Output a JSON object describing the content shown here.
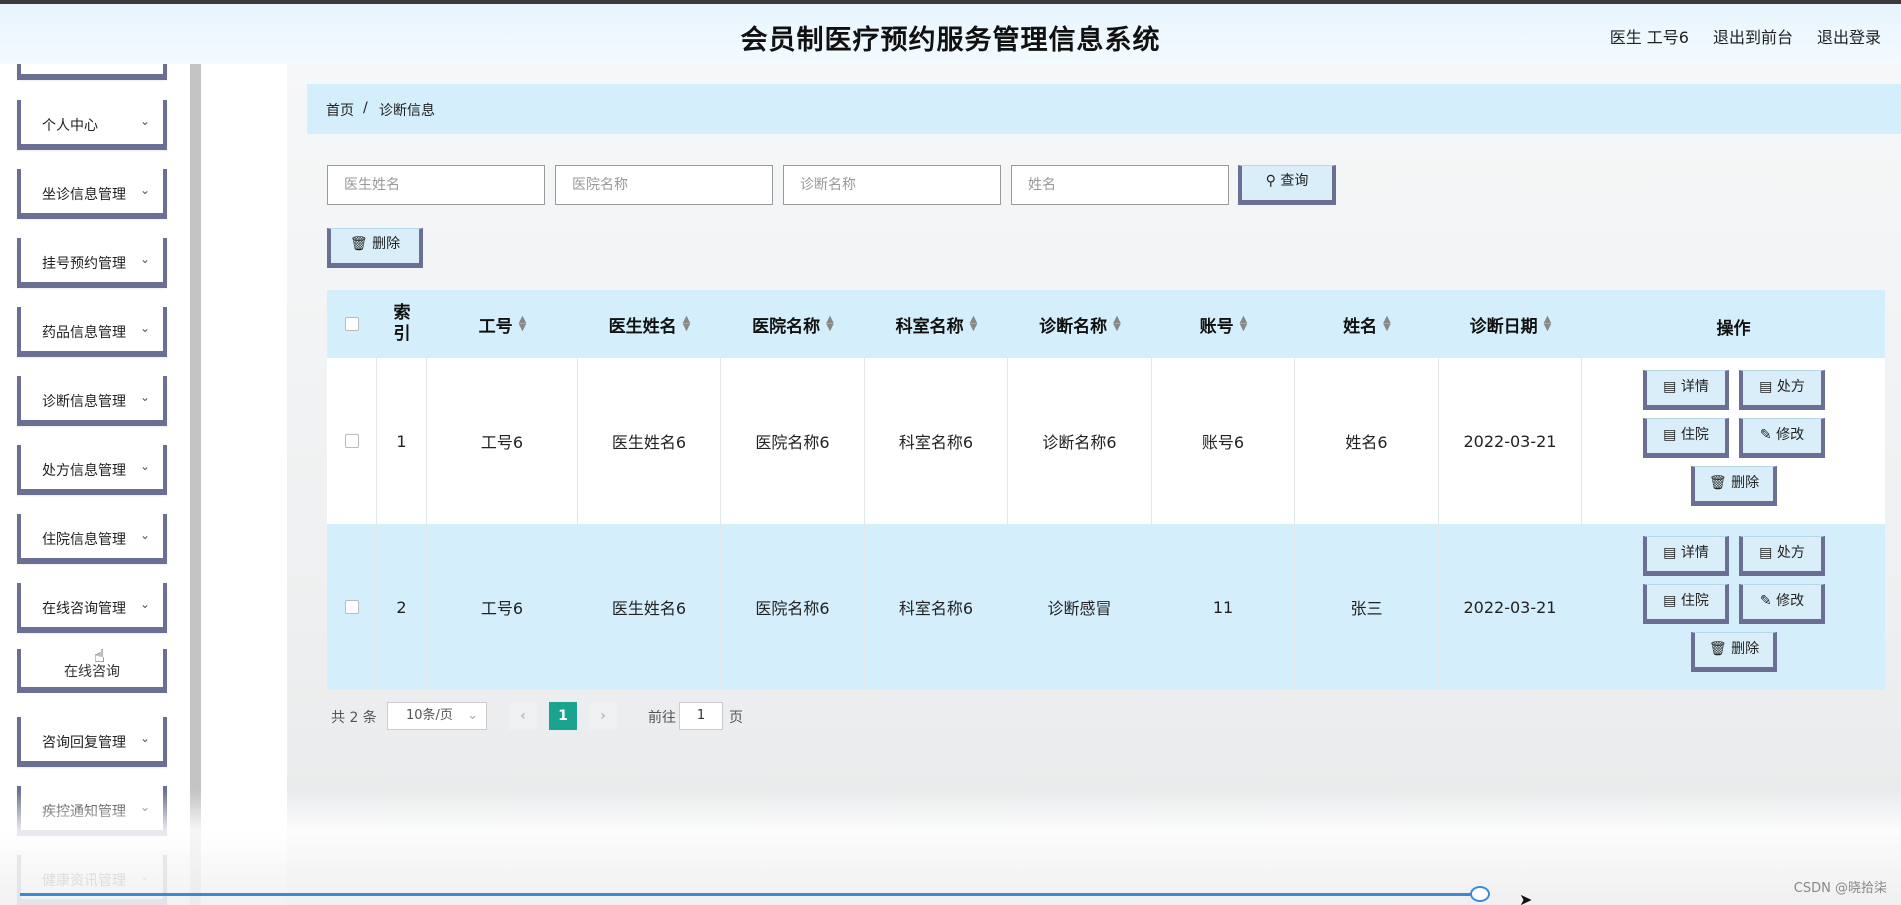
{
  "header": {
    "title": "会员制医疗预约服务管理信息系统",
    "user_label": "医生 工号6",
    "to_front_label": "退出到前台",
    "logout_label": "退出登录"
  },
  "sidebar": {
    "items": [
      {
        "label": "个人中心"
      },
      {
        "label": "坐诊信息管理"
      },
      {
        "label": "挂号预约管理"
      },
      {
        "label": "药品信息管理"
      },
      {
        "label": "诊断信息管理"
      },
      {
        "label": "处方信息管理"
      },
      {
        "label": "住院信息管理"
      },
      {
        "label": "在线咨询管理"
      },
      {
        "label": "咨询回复管理"
      },
      {
        "label": "疾控通知管理"
      },
      {
        "label": "健康资讯管理"
      }
    ],
    "sub_item": "在线咨询"
  },
  "breadcrumb": {
    "home": "首页",
    "separator": "/",
    "current": "诊断信息"
  },
  "search": {
    "doctor_name_placeholder": "医生姓名",
    "hospital_name_placeholder": "医院名称",
    "diagnosis_name_placeholder": "诊断名称",
    "name_placeholder": "姓名",
    "query_label": "查询"
  },
  "toolbar": {
    "delete_label": "删除"
  },
  "table": {
    "headers": {
      "index": "索引",
      "job_no": "工号",
      "doctor_name": "医生姓名",
      "hospital_name": "医院名称",
      "department_name": "科室名称",
      "diagnosis_name": "诊断名称",
      "account": "账号",
      "name": "姓名",
      "diagnosis_date": "诊断日期",
      "actions": "操作"
    },
    "rows": [
      {
        "index": "1",
        "job_no": "工号6",
        "doctor_name": "医生姓名6",
        "hospital_name": "医院名称6",
        "department_name": "科室名称6",
        "diagnosis_name": "诊断名称6",
        "account": "账号6",
        "name": "姓名6",
        "diagnosis_date": "2022-03-21"
      },
      {
        "index": "2",
        "job_no": "工号6",
        "doctor_name": "医生姓名6",
        "hospital_name": "医院名称6",
        "department_name": "科室名称6",
        "diagnosis_name": "诊断感冒",
        "account": "11",
        "name": "张三",
        "diagnosis_date": "2022-03-21"
      }
    ],
    "actions": {
      "detail": "详情",
      "prescription": "处方",
      "hospitalize": "住院",
      "edit": "修改",
      "delete": "删除"
    }
  },
  "pagination": {
    "total": "共 2 条",
    "page_size": "10条/页",
    "current_page": "1",
    "goto_prefix": "前往",
    "goto_value": "1",
    "goto_suffix": "页"
  },
  "watermark": "CSDN @晓拾柒",
  "colors": {
    "accent_border": "#6a6f93",
    "header_bg": "#d4eefb",
    "page_active": "#19a48f"
  }
}
